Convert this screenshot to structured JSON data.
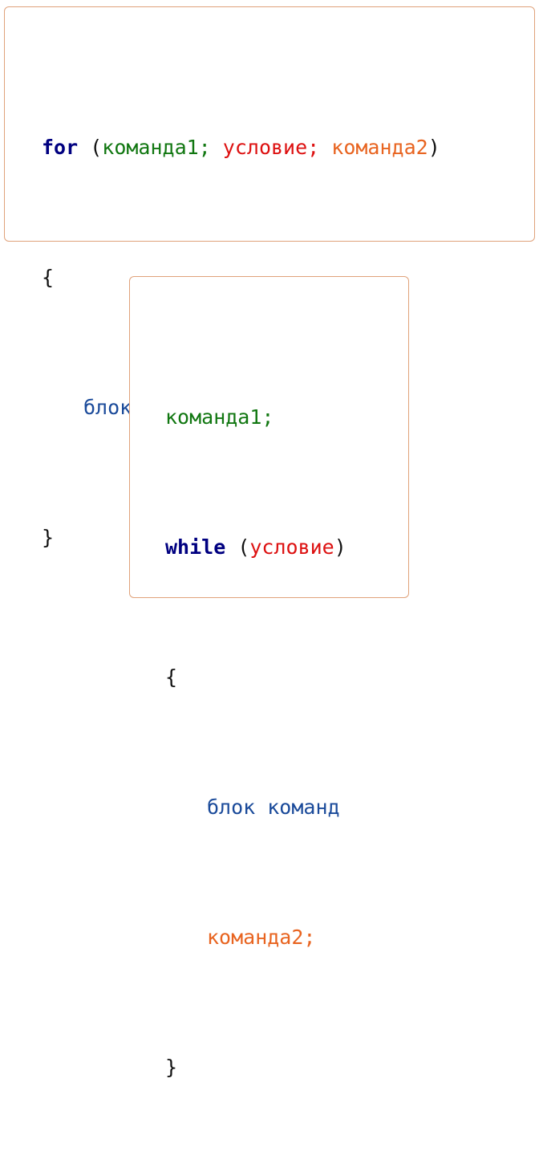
{
  "for_block": {
    "keyword": "for",
    "open_paren": " (",
    "command1": "команда1;",
    "condition": "условие;",
    "command2": "команда2",
    "close_paren": ")",
    "open_brace": "{",
    "body": "блок команд",
    "close_brace": "}"
  },
  "while_block": {
    "command1": "команда1;",
    "keyword": "while",
    "open_paren": " (",
    "condition": "условие",
    "close_paren": ")",
    "open_brace": "{",
    "body": "блок команд",
    "command2": "команда2;",
    "close_brace": "}"
  },
  "colors": {
    "keyword": "#000080",
    "command1": "#117711",
    "condition": "#dd1111",
    "command2": "#e86420",
    "body": "#1a4a9a",
    "box_border": "#e0a27a"
  }
}
